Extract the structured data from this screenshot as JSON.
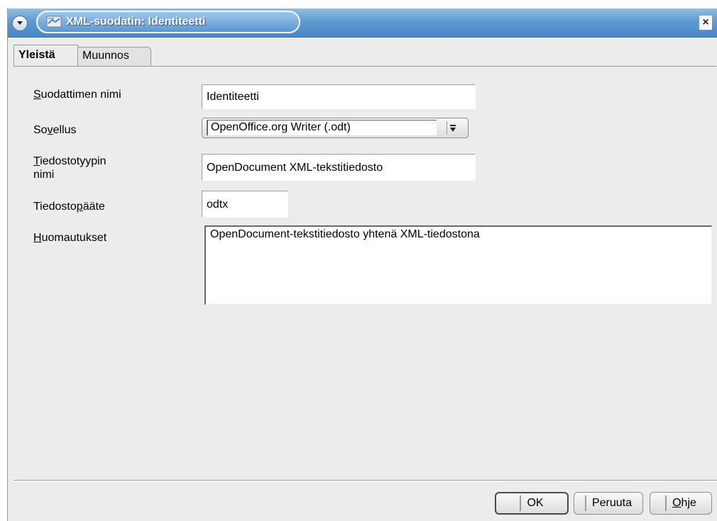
{
  "window": {
    "title": "XML-suodatin: Identiteetti",
    "close_glyph": "×"
  },
  "tabs": [
    {
      "label": "Yleistä",
      "active": true
    },
    {
      "label": "Muunnos",
      "active": false
    }
  ],
  "form": {
    "filter_name": {
      "label_mnemonic": "S",
      "label_rest": "uodattimen nimi",
      "value": "Identiteetti"
    },
    "application": {
      "label_pre": "So",
      "label_mnemonic": "v",
      "label_rest": "ellus",
      "value": "OpenOffice.org Writer (.odt)"
    },
    "file_type_name": {
      "label_mnemonic": "T",
      "label_rest": "iedostotyypin",
      "label_line2": "nimi",
      "value": "OpenDocument XML-tekstitiedosto"
    },
    "file_extension": {
      "label_pre": "Tiedosto",
      "label_mnemonic": "p",
      "label_rest": "ääte",
      "value": "odtx"
    },
    "comments": {
      "label_mnemonic": "H",
      "label_rest": "uomautukset",
      "value": "OpenDocument-tekstitiedosto yhtenä XML-tiedostona"
    }
  },
  "buttons": {
    "ok": "OK",
    "cancel": "Peruuta",
    "help_mnemonic": "O",
    "help_rest": "hje"
  },
  "colors": {
    "titlebar": "#5f9ad0",
    "dialog_bg": "#ececec"
  }
}
